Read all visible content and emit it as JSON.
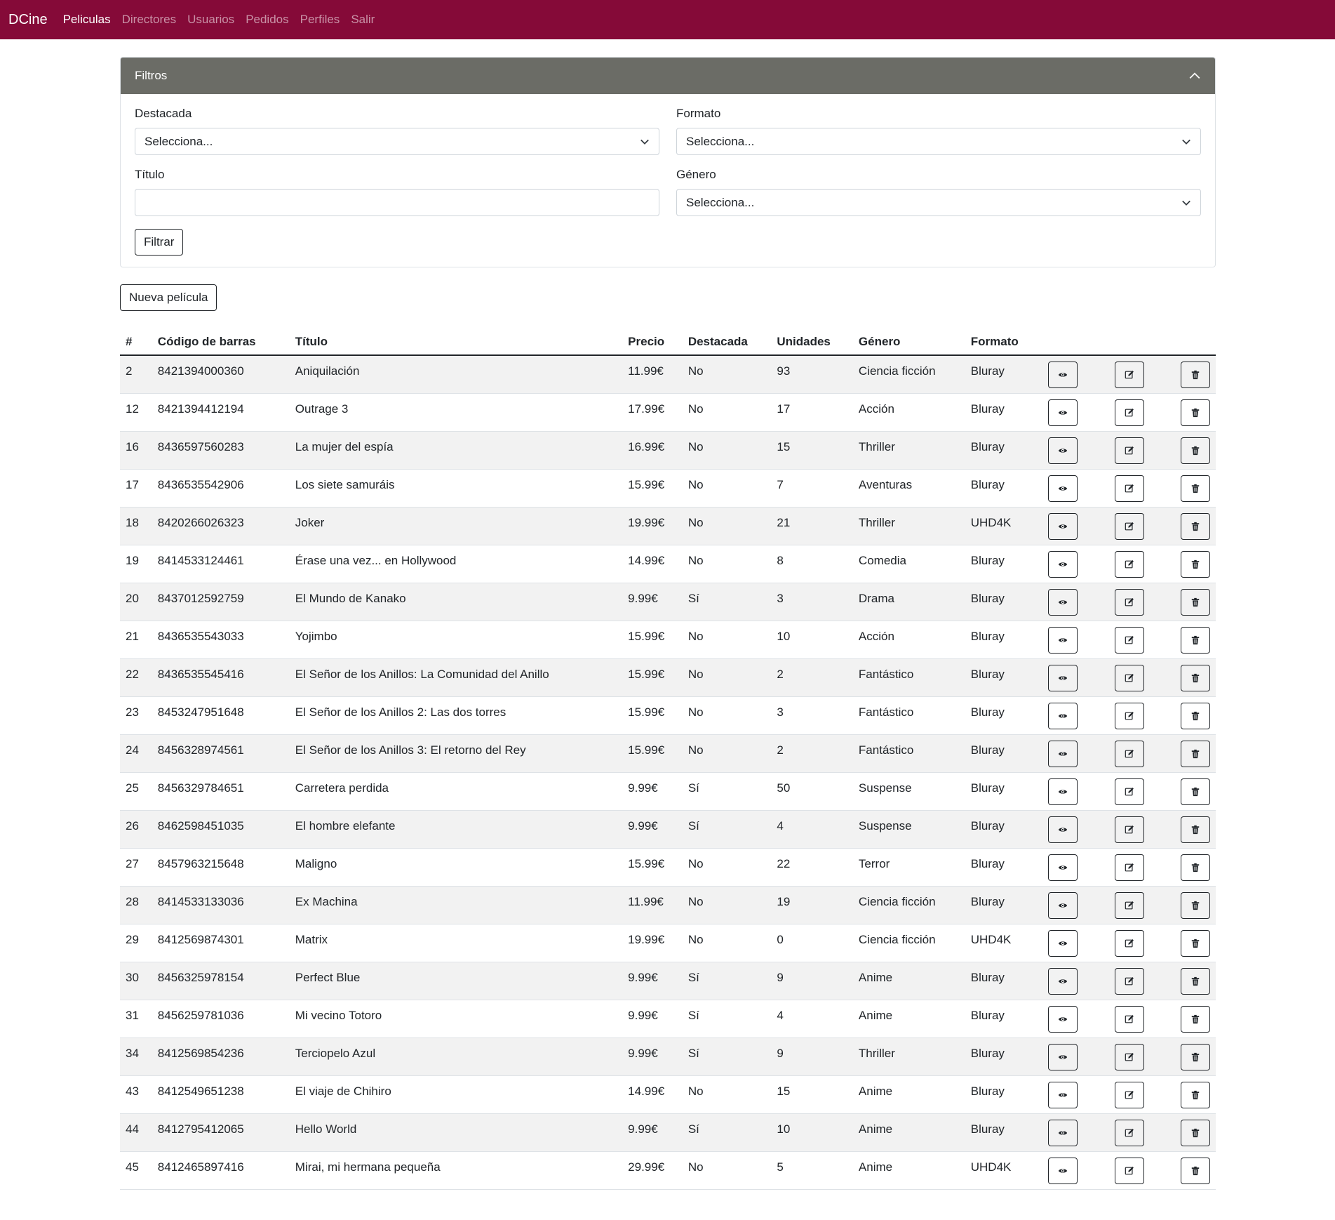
{
  "nav": {
    "brand": "DCine",
    "links": [
      "Peliculas",
      "Directores",
      "Usuarios",
      "Pedidos",
      "Perfiles",
      "Salir"
    ]
  },
  "filters": {
    "title": "Filtros",
    "destacada_label": "Destacada",
    "destacada_value": "Selecciona...",
    "formato_label": "Formato",
    "formato_value": "Selecciona...",
    "titulo_label": "Título",
    "titulo_value": "",
    "genero_label": "Género",
    "genero_value": "Selecciona...",
    "filter_button": "Filtrar"
  },
  "new_button": "Nueva película",
  "table": {
    "headers": [
      "#",
      "Código de barras",
      "Título",
      "Precio",
      "Destacada",
      "Unidades",
      "Género",
      "Formato"
    ],
    "rows": [
      [
        "2",
        "8421394000360",
        "Aniquilación",
        "11.99€",
        "No",
        "93",
        "Ciencia ficción",
        "Bluray"
      ],
      [
        "12",
        "8421394412194",
        "Outrage 3",
        "17.99€",
        "No",
        "17",
        "Acción",
        "Bluray"
      ],
      [
        "16",
        "8436597560283",
        "La mujer del espía",
        "16.99€",
        "No",
        "15",
        "Thriller",
        "Bluray"
      ],
      [
        "17",
        "8436535542906",
        "Los siete samuráis",
        "15.99€",
        "No",
        "7",
        "Aventuras",
        "Bluray"
      ],
      [
        "18",
        "8420266026323",
        "Joker",
        "19.99€",
        "No",
        "21",
        "Thriller",
        "UHD4K"
      ],
      [
        "19",
        "8414533124461",
        "Érase una vez... en Hollywood",
        "14.99€",
        "No",
        "8",
        "Comedia",
        "Bluray"
      ],
      [
        "20",
        "8437012592759",
        "El Mundo de Kanako",
        "9.99€",
        "Sí",
        "3",
        "Drama",
        "Bluray"
      ],
      [
        "21",
        "8436535543033",
        "Yojimbo",
        "15.99€",
        "No",
        "10",
        "Acción",
        "Bluray"
      ],
      [
        "22",
        "8436535545416",
        "El Señor de los Anillos: La Comunidad del Anillo",
        "15.99€",
        "No",
        "2",
        "Fantástico",
        "Bluray"
      ],
      [
        "23",
        "8453247951648",
        "El Señor de los Anillos 2: Las dos torres",
        "15.99€",
        "No",
        "3",
        "Fantástico",
        "Bluray"
      ],
      [
        "24",
        "8456328974561",
        "El Señor de los Anillos 3: El retorno del Rey",
        "15.99€",
        "No",
        "2",
        "Fantástico",
        "Bluray"
      ],
      [
        "25",
        "8456329784651",
        "Carretera perdida",
        "9.99€",
        "Sí",
        "50",
        "Suspense",
        "Bluray"
      ],
      [
        "26",
        "8462598451035",
        "El hombre elefante",
        "9.99€",
        "Sí",
        "4",
        "Suspense",
        "Bluray"
      ],
      [
        "27",
        "8457963215648",
        "Maligno",
        "15.99€",
        "No",
        "22",
        "Terror",
        "Bluray"
      ],
      [
        "28",
        "8414533133036",
        "Ex Machina",
        "11.99€",
        "No",
        "19",
        "Ciencia ficción",
        "Bluray"
      ],
      [
        "29",
        "8412569874301",
        "Matrix",
        "19.99€",
        "No",
        "0",
        "Ciencia ficción",
        "UHD4K"
      ],
      [
        "30",
        "8456325978154",
        "Perfect Blue",
        "9.99€",
        "Sí",
        "9",
        "Anime",
        "Bluray"
      ],
      [
        "31",
        "8456259781036",
        "Mi vecino Totoro",
        "9.99€",
        "Sí",
        "4",
        "Anime",
        "Bluray"
      ],
      [
        "34",
        "8412569854236",
        "Terciopelo Azul",
        "9.99€",
        "Sí",
        "9",
        "Thriller",
        "Bluray"
      ],
      [
        "43",
        "8412549651238",
        "El viaje de Chihiro",
        "14.99€",
        "No",
        "15",
        "Anime",
        "Bluray"
      ],
      [
        "44",
        "8412795412065",
        "Hello World",
        "9.99€",
        "Sí",
        "10",
        "Anime",
        "Bluray"
      ],
      [
        "45",
        "8412465897416",
        "Mirai, mi hermana pequeña",
        "29.99€",
        "No",
        "5",
        "Anime",
        "UHD4K"
      ]
    ],
    "row_actions": [
      "eye-icon",
      "edit-icon",
      "trash-icon"
    ]
  },
  "colors": {
    "navbar": "#850a38",
    "filter_header": "#6b6c66"
  }
}
